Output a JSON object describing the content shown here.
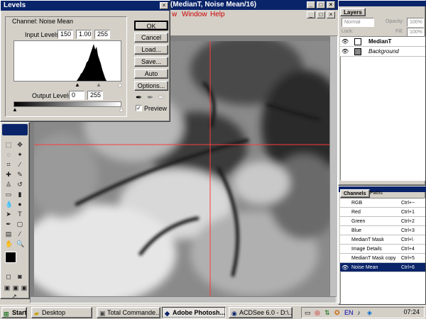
{
  "app": {
    "title_fragment": "(MedianT, Noise Mean/16)",
    "menu": [
      "w",
      "Window",
      "Help"
    ]
  },
  "levels": {
    "title": "Levels",
    "channel_label": "Channel:",
    "channel_value": "Noise Mean",
    "input_label": "Input Levels:",
    "input_black": "150",
    "input_gamma": "1.00",
    "input_white": "255",
    "output_label": "Output Levels:",
    "output_black": "0",
    "output_white": "255",
    "buttons": [
      "OK",
      "Cancel",
      "Load...",
      "Save...",
      "Auto",
      "Options..."
    ],
    "preview_label": "Preview",
    "preview_checked": true
  },
  "layers_palette": {
    "tab": "Layers",
    "mode": "Normal",
    "opacity_label": "Opacity:",
    "opacity_value": "100%",
    "lock_label": "Lock:",
    "fill_label": "Fill:",
    "fill_value": "100%",
    "layers": [
      {
        "name": "MedianT",
        "bold": true
      },
      {
        "name": "Background",
        "bold": false
      }
    ]
  },
  "channels_palette": {
    "tabs": [
      "Channels",
      "Paths"
    ],
    "channels": [
      {
        "name": "RGB",
        "shortcut": "Ctrl+~"
      },
      {
        "name": "Red",
        "shortcut": "Ctrl+1"
      },
      {
        "name": "Green",
        "shortcut": "Ctrl+2"
      },
      {
        "name": "Blue",
        "shortcut": "Ctrl+3"
      },
      {
        "name": "MedianT Mask",
        "shortcut": "Ctrl+\\"
      },
      {
        "name": "Image Details",
        "shortcut": "Ctrl+4"
      },
      {
        "name": "MedianT Mask copy",
        "shortcut": "Ctrl+5"
      },
      {
        "name": "Noise Mean",
        "shortcut": "Ctrl+6",
        "selected": true
      }
    ]
  },
  "taskbar": {
    "start_label": "Start",
    "tasks": [
      "Desktop",
      "Total Commande...",
      "Adobe Photosh...",
      "ACDSee 6.0 - D:\\..."
    ],
    "active_task_index": 2,
    "clock": "07:24"
  },
  "colors": {
    "titlebar": "#0a246a",
    "guide": "#ff3b3b"
  }
}
